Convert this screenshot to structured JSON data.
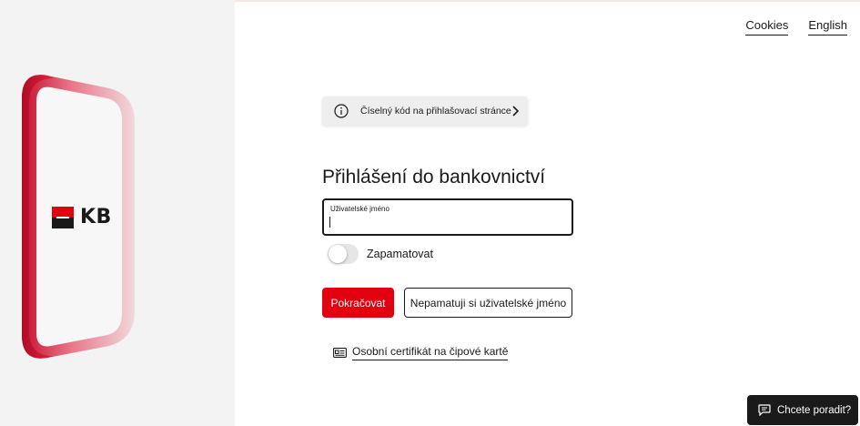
{
  "brand": {
    "logo_text": "KB"
  },
  "header": {
    "links": [
      {
        "label": "Cookies"
      },
      {
        "label": "English"
      }
    ]
  },
  "info_banner": {
    "text": "Číselný kód na přihlašovací stránce",
    "icon": "info-icon"
  },
  "login": {
    "title": "Přihlášení do bankovnictví",
    "username": {
      "label": "Uživatelské jméno",
      "value": ""
    },
    "remember": {
      "label": "Zapamatovat",
      "checked": false
    },
    "continue_label": "Pokračovat",
    "forgot_label": "Nepamatuji si uživatelské jméno",
    "cert_link": {
      "label": "Osobní certifikát na čipové kartě",
      "icon": "id-card-icon"
    }
  },
  "chat": {
    "label": "Chcete poradit?",
    "icon": "chat-icon"
  },
  "colors": {
    "brand_red": "#e3000f",
    "text": "#1a1a1a",
    "panel": "#f3f3f3"
  }
}
